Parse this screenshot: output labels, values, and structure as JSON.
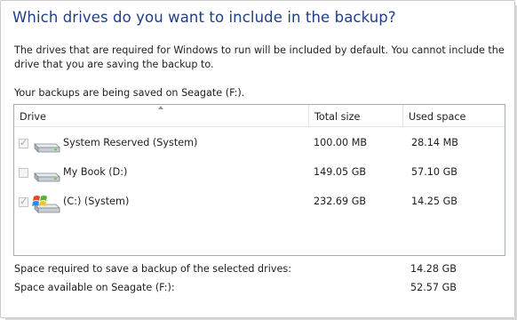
{
  "header": {
    "title": "Which drives do you want to include in the backup?"
  },
  "description": "The drives that are required for Windows to run will be included by default. You cannot include the drive that you are saving the backup to.",
  "saved_location": "Your backups are being saved on Seagate (F:).",
  "table": {
    "columns": [
      "Drive",
      "Total size",
      "Used space"
    ],
    "rows": [
      {
        "name": "System Reserved (System)",
        "total": "100.00 MB",
        "used": "28.14 MB",
        "checked": true,
        "icon": "hard-drive-icon"
      },
      {
        "name": "My Book (D:)",
        "total": "149.05 GB",
        "used": "57.10 GB",
        "checked": false,
        "icon": "hard-drive-icon"
      },
      {
        "name": "(C:) (System)",
        "total": "232.69 GB",
        "used": "14.25 GB",
        "checked": true,
        "icon": "windows-drive-icon"
      }
    ]
  },
  "footer": {
    "required_label": "Space required to save a backup of the selected drives:",
    "required_value": "14.28 GB",
    "available_label": "Space available on Seagate (F:):",
    "available_value": "52.57 GB"
  },
  "colors": {
    "title": "#1f3f86",
    "table_border": "#a5acb5"
  }
}
